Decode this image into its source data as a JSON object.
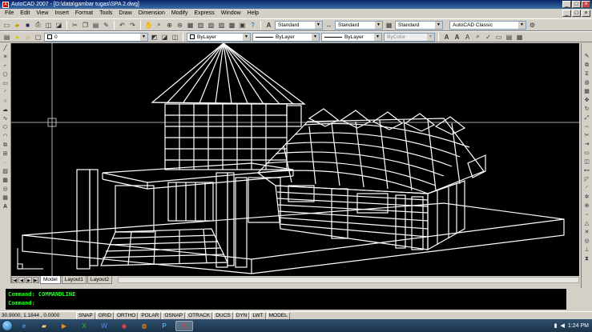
{
  "window": {
    "title": "AutoCAD 2007 - [D:\\data\\gambar tugas\\SPA 2.dwg]",
    "minimize": "_",
    "maximize": "□",
    "close": "×"
  },
  "menu": [
    "File",
    "Edit",
    "View",
    "Insert",
    "Format",
    "Tools",
    "Draw",
    "Dimension",
    "Modify",
    "Express",
    "Window",
    "Help"
  ],
  "toolbar": {
    "text_style": "Standard",
    "dim_style": "Standard",
    "table_style": "Standard",
    "workspace": "AutoCAD Classic"
  },
  "properties": {
    "layer": "0",
    "color": "ByLayer",
    "linetype": "ByLayer",
    "lineweight": "ByLayer",
    "plotstyle": "ByColor"
  },
  "layout_tabs": [
    "Model",
    "Layout1",
    "Layout2"
  ],
  "active_tab": "Model",
  "command": {
    "history": "Command: COMMANDLINE",
    "prompt": "Command:"
  },
  "status": {
    "coords": "30.9000, 1.1844 , 0.0000",
    "toggles": [
      "SNAP",
      "GRID",
      "ORTHO",
      "POLAR",
      "OSNAP",
      "OTRACK",
      "DUCS",
      "DYN",
      "LWT",
      "MODEL"
    ]
  },
  "taskbar": {
    "time": "1:24 PM"
  },
  "colors": {
    "canvas": "#000000",
    "drawing_lines": "#ffffff",
    "command_text": "#22ff22",
    "title_bar": "#0a246a"
  }
}
